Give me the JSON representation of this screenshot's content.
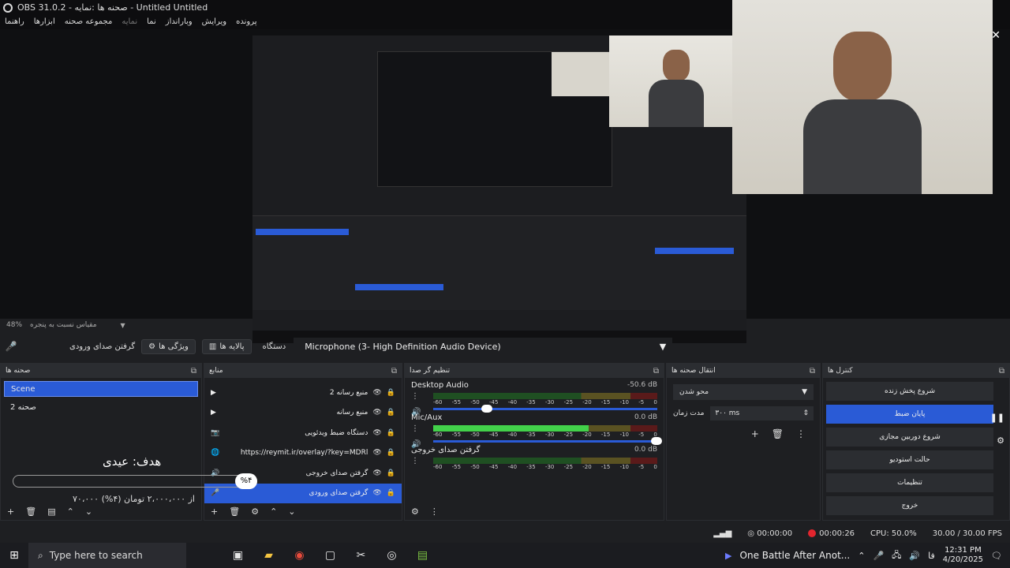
{
  "window": {
    "title": "OBS 31.0.2 - صحنه ها :نمایه - Untitled Untitled"
  },
  "menu": [
    "راهنما",
    "ابزارها",
    "مجموعه صحنه",
    "نمایه",
    "نما",
    "وبارانداز",
    "ویرایش",
    "پرونده"
  ],
  "preview_zoom": {
    "percent": "48%",
    "label": "مقیاس نسبت به پنجره"
  },
  "source_toolbar": {
    "source_name": "گرفتن صدای ورودی",
    "properties_label": "ویژگی ها",
    "filters_label": "پالایه ها",
    "device_label": "دستگاه",
    "device_value": "Microphone (3- High Definition Audio Device)"
  },
  "scenes": {
    "title": "صحنه ها",
    "items": [
      {
        "label": "Scene"
      },
      {
        "label": "صحنه 2"
      }
    ]
  },
  "sources": {
    "title": "منابع",
    "items": [
      {
        "label": "منبع رسانه 2",
        "icon": "play-icon"
      },
      {
        "label": "منبع رسانه",
        "icon": "play-icon"
      },
      {
        "label": "دستگاه ضبط ویدئویی",
        "icon": "camera-icon"
      },
      {
        "label": "https://reymit.ir/overlay/?key=MDRl",
        "icon": "globe-icon"
      },
      {
        "label": "گرفتن صدای خروجی",
        "icon": "speaker-icon"
      },
      {
        "label": "گرفتن صدای ورودی",
        "icon": "mic-icon"
      }
    ]
  },
  "mixer": {
    "title": "تنظیم گر صدا",
    "scale": [
      "-60",
      "-55",
      "-50",
      "-45",
      "-40",
      "-35",
      "-30",
      "-25",
      "-20",
      "-15",
      "-10",
      "-5",
      "0"
    ],
    "channels": [
      {
        "name": "Desktop Audio",
        "db": "-50.6 dB",
        "level": 0,
        "volume": 0.22
      },
      {
        "name": "Mic/Aux",
        "db": "0.0 dB",
        "level": 0.68,
        "volume": 1.0
      },
      {
        "name": "گرفتن صدای خروجی",
        "db": "0.0 dB",
        "level": 0,
        "volume": 1.0
      }
    ]
  },
  "transitions": {
    "title": "انتقال صحنه ها",
    "type": "محو شدن",
    "duration_label": "مدت زمان",
    "duration_value": "۳۰۰ ms"
  },
  "controls": {
    "title": "کنترل ها",
    "buttons": [
      {
        "label": "شروع پخش زنده",
        "active": false
      },
      {
        "label": "پایان ضبط",
        "active": true
      },
      {
        "label": "شروع دوربین مجازی",
        "active": false
      },
      {
        "label": "حالت استودیو",
        "active": false
      },
      {
        "label": "تنظیمات",
        "active": false
      },
      {
        "label": "خروج",
        "active": false
      }
    ]
  },
  "overlay_widget": {
    "goal": "هدف: عیدی",
    "percent": "%۴",
    "amount": "۷۰،۰۰۰ از ۲،۰۰۰،۰۰۰ تومان (۴%)"
  },
  "status": {
    "stream_time": "00:00:00",
    "rec_time": "00:00:26",
    "cpu": "CPU: 50.0%",
    "fps": "30.00 / 30.00 FPS"
  },
  "taskbar": {
    "search_placeholder": "Type here to search",
    "media": "One Battle After Anot...",
    "lang": "فا",
    "time": "12:31 PM",
    "date": "4/20/2025"
  }
}
